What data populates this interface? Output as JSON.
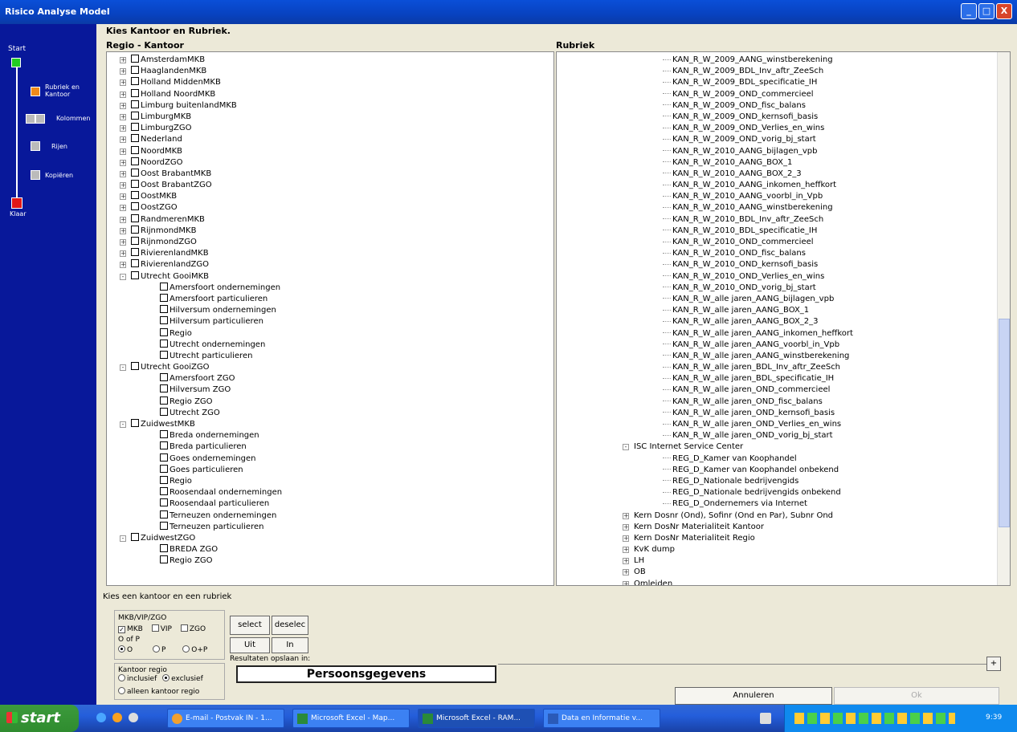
{
  "window": {
    "title": "Risico Analyse Model",
    "min": "_",
    "max": "□",
    "close": "X"
  },
  "wizard": {
    "steps": [
      "Start",
      "Rubriek en Kantoor",
      "Kolommen",
      "Rijen",
      "Kopiëren",
      "Klaar"
    ]
  },
  "header": "Kies Kantoor en Rubriek.",
  "left_panel": {
    "title": "Regio - Kantoor",
    "items": [
      {
        "label": "AmsterdamMKB",
        "level": 0,
        "exp": "+"
      },
      {
        "label": "HaaglandenMKB",
        "level": 0,
        "exp": "+"
      },
      {
        "label": "Holland MiddenMKB",
        "level": 0,
        "exp": "+"
      },
      {
        "label": "Holland NoordMKB",
        "level": 0,
        "exp": "+"
      },
      {
        "label": "Limburg buitenlandMKB",
        "level": 0,
        "exp": "+"
      },
      {
        "label": "LimburgMKB",
        "level": 0,
        "exp": "+"
      },
      {
        "label": "LimburgZGO",
        "level": 0,
        "exp": "+"
      },
      {
        "label": "Nederland",
        "level": 0,
        "exp": "+"
      },
      {
        "label": "NoordMKB",
        "level": 0,
        "exp": "+"
      },
      {
        "label": "NoordZGO",
        "level": 0,
        "exp": "+"
      },
      {
        "label": "Oost BrabantMKB",
        "level": 0,
        "exp": "+"
      },
      {
        "label": "Oost BrabantZGO",
        "level": 0,
        "exp": "+"
      },
      {
        "label": "OostMKB",
        "level": 0,
        "exp": "+"
      },
      {
        "label": "OostZGO",
        "level": 0,
        "exp": "+"
      },
      {
        "label": "RandmerenMKB",
        "level": 0,
        "exp": "+"
      },
      {
        "label": "RijnmondMKB",
        "level": 0,
        "exp": "+"
      },
      {
        "label": "RijnmondZGO",
        "level": 0,
        "exp": "+"
      },
      {
        "label": "RivierenlandMKB",
        "level": 0,
        "exp": "+"
      },
      {
        "label": "RivierenlandZGO",
        "level": 0,
        "exp": "+"
      },
      {
        "label": "Utrecht GooiMKB",
        "level": 0,
        "exp": "-"
      },
      {
        "label": "Amersfoort ondernemingen",
        "level": 1
      },
      {
        "label": "Amersfoort particulieren",
        "level": 1
      },
      {
        "label": "Hilversum ondernemingen",
        "level": 1
      },
      {
        "label": "Hilversum particulieren",
        "level": 1
      },
      {
        "label": "Regio",
        "level": 1
      },
      {
        "label": "Utrecht ondernemingen",
        "level": 1
      },
      {
        "label": "Utrecht particulieren",
        "level": 1
      },
      {
        "label": "Utrecht GooiZGO",
        "level": 0,
        "exp": "-"
      },
      {
        "label": "Amersfoort ZGO",
        "level": 1
      },
      {
        "label": "Hilversum ZGO",
        "level": 1
      },
      {
        "label": "Regio ZGO",
        "level": 1
      },
      {
        "label": "Utrecht ZGO",
        "level": 1
      },
      {
        "label": "ZuidwestMKB",
        "level": 0,
        "exp": "-"
      },
      {
        "label": "Breda ondernemingen",
        "level": 1
      },
      {
        "label": "Breda particulieren",
        "level": 1
      },
      {
        "label": "Goes ondernemingen",
        "level": 1
      },
      {
        "label": "Goes particulieren",
        "level": 1
      },
      {
        "label": "Regio",
        "level": 1
      },
      {
        "label": "Roosendaal ondernemingen",
        "level": 1
      },
      {
        "label": "Roosendaal particulieren",
        "level": 1
      },
      {
        "label": "Terneuzen ondernemingen",
        "level": 1
      },
      {
        "label": "Terneuzen particulieren",
        "level": 1
      },
      {
        "label": "ZuidwestZGO",
        "level": 0,
        "exp": "-"
      },
      {
        "label": "BREDA ZGO",
        "level": 1
      },
      {
        "label": "Regio ZGO",
        "level": 1
      }
    ]
  },
  "right_panel": {
    "title": "Rubriek",
    "items": [
      {
        "label": "KAN_R_W_2009_AANG_winstberekening",
        "level": 2
      },
      {
        "label": "KAN_R_W_2009_BDL_Inv_aftr_ZeeSch",
        "level": 2
      },
      {
        "label": "KAN_R_W_2009_BDL_specificatie_IH",
        "level": 2
      },
      {
        "label": "KAN_R_W_2009_OND_commercieel",
        "level": 2
      },
      {
        "label": "KAN_R_W_2009_OND_fisc_balans",
        "level": 2
      },
      {
        "label": "KAN_R_W_2009_OND_kernsofi_basis",
        "level": 2
      },
      {
        "label": "KAN_R_W_2009_OND_Verlies_en_wins",
        "level": 2
      },
      {
        "label": "KAN_R_W_2009_OND_vorig_bj_start",
        "level": 2
      },
      {
        "label": "KAN_R_W_2010_AANG_bijlagen_vpb",
        "level": 2
      },
      {
        "label": "KAN_R_W_2010_AANG_BOX_1",
        "level": 2
      },
      {
        "label": "KAN_R_W_2010_AANG_BOX_2_3",
        "level": 2
      },
      {
        "label": "KAN_R_W_2010_AANG_inkomen_heffkort",
        "level": 2
      },
      {
        "label": "KAN_R_W_2010_AANG_voorbl_in_Vpb",
        "level": 2
      },
      {
        "label": "KAN_R_W_2010_AANG_winstberekening",
        "level": 2
      },
      {
        "label": "KAN_R_W_2010_BDL_Inv_aftr_ZeeSch",
        "level": 2
      },
      {
        "label": "KAN_R_W_2010_BDL_specificatie_IH",
        "level": 2
      },
      {
        "label": "KAN_R_W_2010_OND_commercieel",
        "level": 2
      },
      {
        "label": "KAN_R_W_2010_OND_fisc_balans",
        "level": 2
      },
      {
        "label": "KAN_R_W_2010_OND_kernsofi_basis",
        "level": 2
      },
      {
        "label": "KAN_R_W_2010_OND_Verlies_en_wins",
        "level": 2
      },
      {
        "label": "KAN_R_W_2010_OND_vorig_bj_start",
        "level": 2
      },
      {
        "label": "KAN_R_W_alle jaren_AANG_bijlagen_vpb",
        "level": 2
      },
      {
        "label": "KAN_R_W_alle jaren_AANG_BOX_1",
        "level": 2
      },
      {
        "label": "KAN_R_W_alle jaren_AANG_BOX_2_3",
        "level": 2
      },
      {
        "label": "KAN_R_W_alle jaren_AANG_inkomen_heffkort",
        "level": 2
      },
      {
        "label": "KAN_R_W_alle jaren_AANG_voorbl_in_Vpb",
        "level": 2
      },
      {
        "label": "KAN_R_W_alle jaren_AANG_winstberekening",
        "level": 2
      },
      {
        "label": "KAN_R_W_alle jaren_BDL_Inv_aftr_ZeeSch",
        "level": 2
      },
      {
        "label": "KAN_R_W_alle jaren_BDL_specificatie_IH",
        "level": 2
      },
      {
        "label": "KAN_R_W_alle jaren_OND_commercieel",
        "level": 2
      },
      {
        "label": "KAN_R_W_alle jaren_OND_fisc_balans",
        "level": 2
      },
      {
        "label": "KAN_R_W_alle jaren_OND_kernsofi_basis",
        "level": 2
      },
      {
        "label": "KAN_R_W_alle jaren_OND_Verlies_en_wins",
        "level": 2
      },
      {
        "label": "KAN_R_W_alle jaren_OND_vorig_bj_start",
        "level": 2
      },
      {
        "label": "ISC Internet Service Center",
        "level": 1,
        "exp": "-"
      },
      {
        "label": "REG_D_Kamer van Koophandel",
        "level": 2
      },
      {
        "label": "REG_D_Kamer van Koophandel onbekend",
        "level": 2
      },
      {
        "label": "REG_D_Nationale bedrijvengids",
        "level": 2
      },
      {
        "label": "REG_D_Nationale bedrijvengids onbekend",
        "level": 2
      },
      {
        "label": "REG_D_Ondernemers via Internet",
        "level": 2
      },
      {
        "label": "Kern Dosnr (Ond), Sofinr (Ond en Par), Subnr Ond",
        "level": 1,
        "exp": "+"
      },
      {
        "label": "Kern DosNr Materialiteit Kantoor",
        "level": 1,
        "exp": "+"
      },
      {
        "label": "Kern DosNr Materialiteit Regio",
        "level": 1,
        "exp": "+"
      },
      {
        "label": "KvK dump",
        "level": 1,
        "exp": "+"
      },
      {
        "label": "LH",
        "level": 1,
        "exp": "+"
      },
      {
        "label": "OB",
        "level": 1,
        "exp": "+"
      },
      {
        "label": "Omleiden",
        "level": 1,
        "exp": "+"
      }
    ]
  },
  "footer_hint": "Kies een kantoor en een rubriek",
  "mkb_group": {
    "title": "MKB/VIP/ZGO",
    "mkb": "MKB",
    "vip": "VIP",
    "zgo": "ZGO",
    "oofp_title": "O of P",
    "o": "O",
    "p": "P",
    "op": "O+P"
  },
  "kantoor_group": {
    "title": "Kantoor regio",
    "inclusief": "inclusief",
    "exclusief": "exclusief",
    "alleen": "alleen kantoor regio"
  },
  "buttons": {
    "select": "select",
    "deselect": "deselec",
    "uit": "Uit",
    "in": "In",
    "annuleren": "Annuleren",
    "ok": "Ok",
    "plus": "+"
  },
  "results": {
    "label": "Resultaten opslaan in:",
    "value": "Persoonsgegevens"
  },
  "taskbar": {
    "start": "start",
    "tasks": [
      "E-mail - Postvak IN - 1...",
      "Microsoft Excel - Map...",
      "Microsoft Excel - RAM...",
      "Data en Informatie v..."
    ],
    "clock": "9:39"
  },
  "colors": {
    "accent": "#0a4fd8",
    "wizard_bg": "#08189a",
    "start_green": "#22cc22",
    "active_orange": "#f08a1a",
    "end_red": "#e01818"
  }
}
